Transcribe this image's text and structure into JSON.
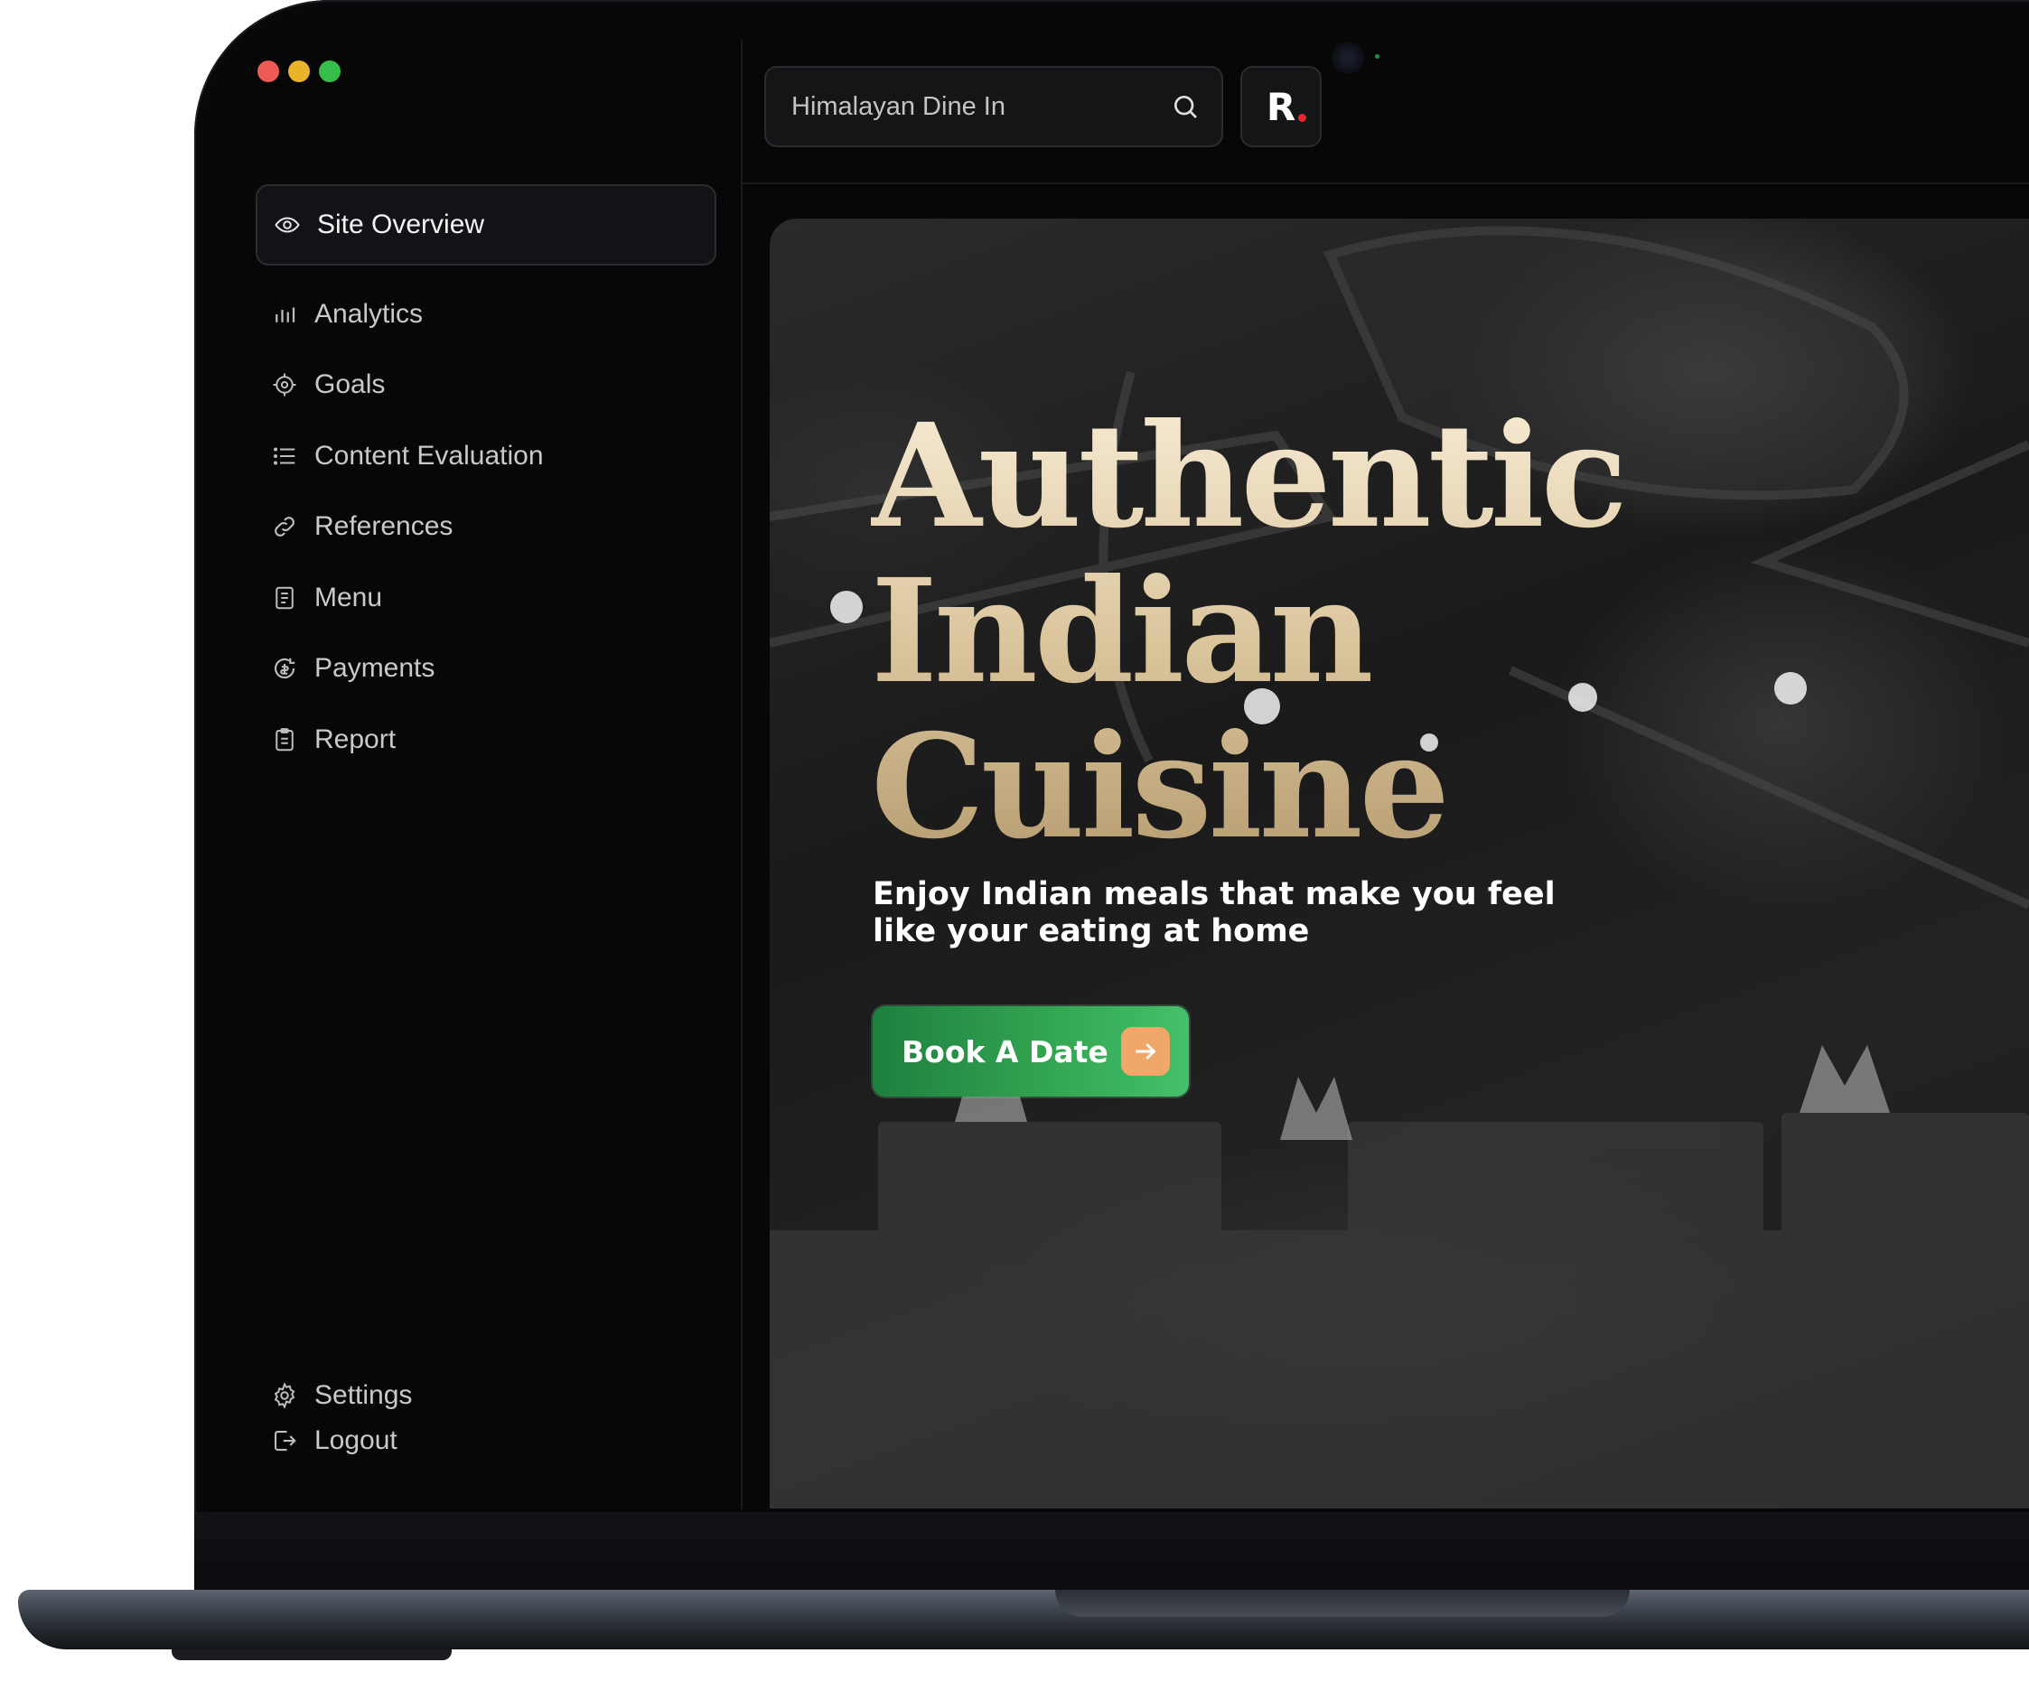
{
  "window": {
    "controls": [
      "close",
      "minimize",
      "maximize"
    ]
  },
  "sidebar": {
    "active_item": {
      "label": "Site Overview",
      "icon": "eye-icon"
    },
    "items": [
      {
        "label": "Analytics",
        "icon": "bar-chart-icon"
      },
      {
        "label": "Goals",
        "icon": "target-icon"
      },
      {
        "label": "Content Evaluation",
        "icon": "list-icon"
      },
      {
        "label": "References",
        "icon": "link-icon"
      },
      {
        "label": "Menu",
        "icon": "document-icon"
      },
      {
        "label": "Payments",
        "icon": "coin-icon"
      },
      {
        "label": "Report",
        "icon": "clipboard-icon"
      }
    ],
    "footer": [
      {
        "label": "Settings",
        "icon": "gear-icon"
      },
      {
        "label": "Logout",
        "icon": "logout-icon"
      }
    ]
  },
  "header": {
    "search": {
      "value": "Himalayan Dine In",
      "icon": "search-icon"
    },
    "logo": {
      "text": "R",
      "dot_color": "#e5262d"
    }
  },
  "hero": {
    "title_lines": [
      "Authentic",
      "Indian",
      "Cuisine"
    ],
    "subtitle": "Enjoy Indian meals that make you feel like your eating at home",
    "cta_label": "Book A Date",
    "cta_icon": "arrow-right-icon",
    "colors": {
      "title": "#e3cfa7",
      "cta": "#34a853",
      "cta_icon_bg": "#f0a76a"
    }
  }
}
